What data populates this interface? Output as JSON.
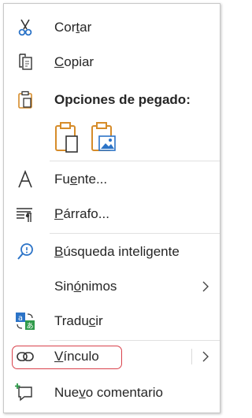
{
  "menu": {
    "cut": {
      "label": "Cortar",
      "mnemonic": "t",
      "icon": "scissors-icon"
    },
    "copy": {
      "label": "Copiar",
      "mnemonic": "C",
      "icon": "copy-icon"
    },
    "paste_options": {
      "label": "Opciones de pegado:",
      "icon": "clipboard-icon",
      "options": [
        {
          "icon": "paste-keep-text-icon"
        },
        {
          "icon": "paste-picture-icon"
        }
      ]
    },
    "font": {
      "label": "Fuente...",
      "mnemonic": "e",
      "icon": "font-icon"
    },
    "paragraph": {
      "label": "Párrafo...",
      "mnemonic": "P",
      "icon": "paragraph-icon"
    },
    "smart_lookup": {
      "label": "Búsqueda inteligente",
      "mnemonic": "B",
      "icon": "search-icon"
    },
    "synonyms": {
      "label": "Sinónimos",
      "mnemonic": "ó",
      "has_submenu": true
    },
    "translate": {
      "label": "Traducir",
      "mnemonic": "c",
      "icon": "translate-icon"
    },
    "link": {
      "label": "Vínculo",
      "mnemonic": "V",
      "icon": "link-icon",
      "has_submenu": true,
      "highlighted": true
    },
    "new_comment": {
      "label": "Nuevo comentario",
      "mnemonic": "v",
      "icon": "comment-icon"
    }
  },
  "colors": {
    "accent_blue": "#2b73c7",
    "accent_orange": "#d68c2a",
    "highlight_red": "#d9414b",
    "text": "#262626"
  }
}
